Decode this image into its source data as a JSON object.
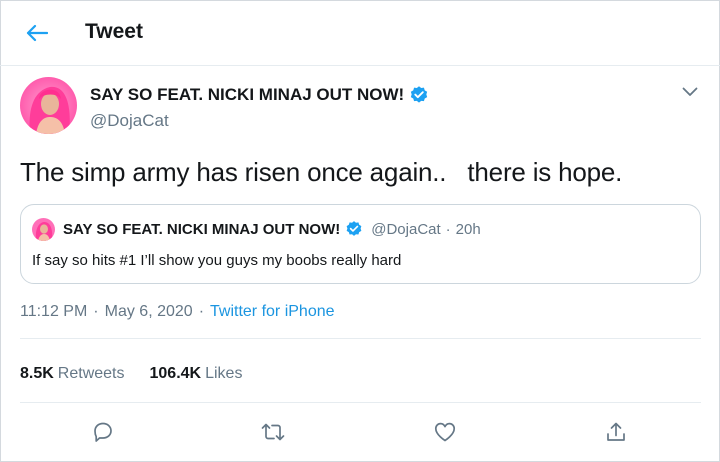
{
  "header": {
    "title": "Tweet",
    "back_icon": "arrow-left-icon"
  },
  "tweet": {
    "display_name": "SAY SO FEAT. NICKI MINAJ OUT NOW!",
    "handle": "@DojaCat",
    "text": "The simp army has risen once again..   there is hope.",
    "time": "11:12 PM",
    "date": "May 6, 2020",
    "source": "Twitter for iPhone",
    "separator": "·"
  },
  "quoted": {
    "display_name": "SAY SO FEAT. NICKI MINAJ OUT NOW!",
    "handle": "@DojaCat",
    "separator": "·",
    "time": "20h",
    "text": "If say so hits #1 I’ll show you guys my boobs really hard"
  },
  "stats": {
    "retweets_count": "8.5K",
    "retweets_label": "Retweets",
    "likes_count": "106.4K",
    "likes_label": "Likes"
  },
  "actions": [
    "reply-icon",
    "retweet-icon",
    "like-icon",
    "share-icon"
  ],
  "colors": {
    "accent": "#1da1f2",
    "link": "#1b95e0",
    "muted": "#657786",
    "text": "#14171a",
    "border": "#e6ecf0"
  }
}
